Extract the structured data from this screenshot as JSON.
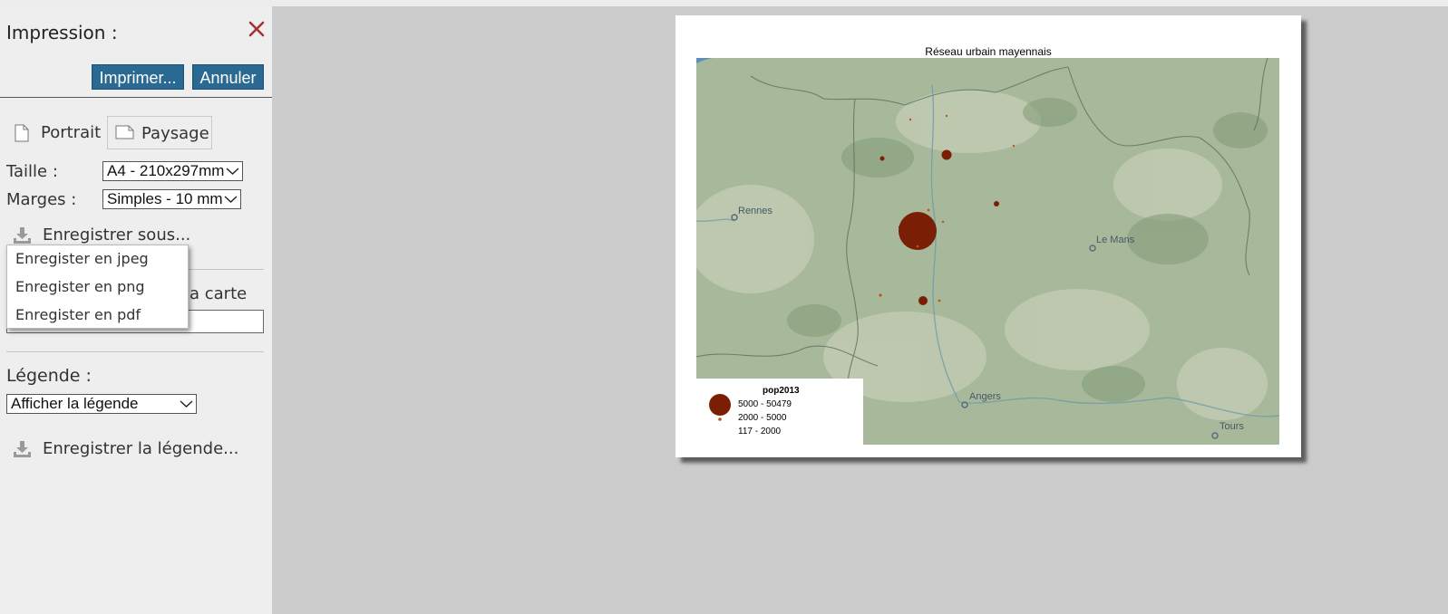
{
  "panel": {
    "title": "Impression :",
    "print_button": "Imprimer...",
    "cancel_button": "Annuler",
    "orientation": {
      "portrait": "Portrait",
      "landscape": "Paysage"
    },
    "size": {
      "label": "Taille :",
      "value": "A4 - 210x297mm"
    },
    "margins": {
      "label": "Marges :",
      "value": "Simples - 10 mm"
    },
    "save_as": "Enregistrer sous...",
    "save_menu": [
      "Enregister en jpeg",
      "Enregister en png",
      "Enregister en pdf"
    ],
    "map_title_label_partial": "a carte",
    "legend": {
      "label": "Légende :",
      "select_value": "Afficher la légende"
    },
    "save_legend": "Enregistrer la légende..."
  },
  "preview": {
    "map_title": "Réseau urbain mayennais",
    "places": [
      "Rennes",
      "Le Mans",
      "Angers",
      "Tours"
    ],
    "legend_title": "pop2013",
    "legend_classes": [
      "5000 - 50479",
      "2000 - 5000",
      "117 - 2000"
    ],
    "symbol_color": "#7a1f05"
  },
  "colors": {
    "button": "#2a6992",
    "close": "#a33333",
    "panel": "#eeeeee",
    "canvas": "#cccccc"
  },
  "icons": [
    "close-icon",
    "portrait-page-icon",
    "landscape-page-icon",
    "download-icon",
    "chevron-down-icon"
  ]
}
